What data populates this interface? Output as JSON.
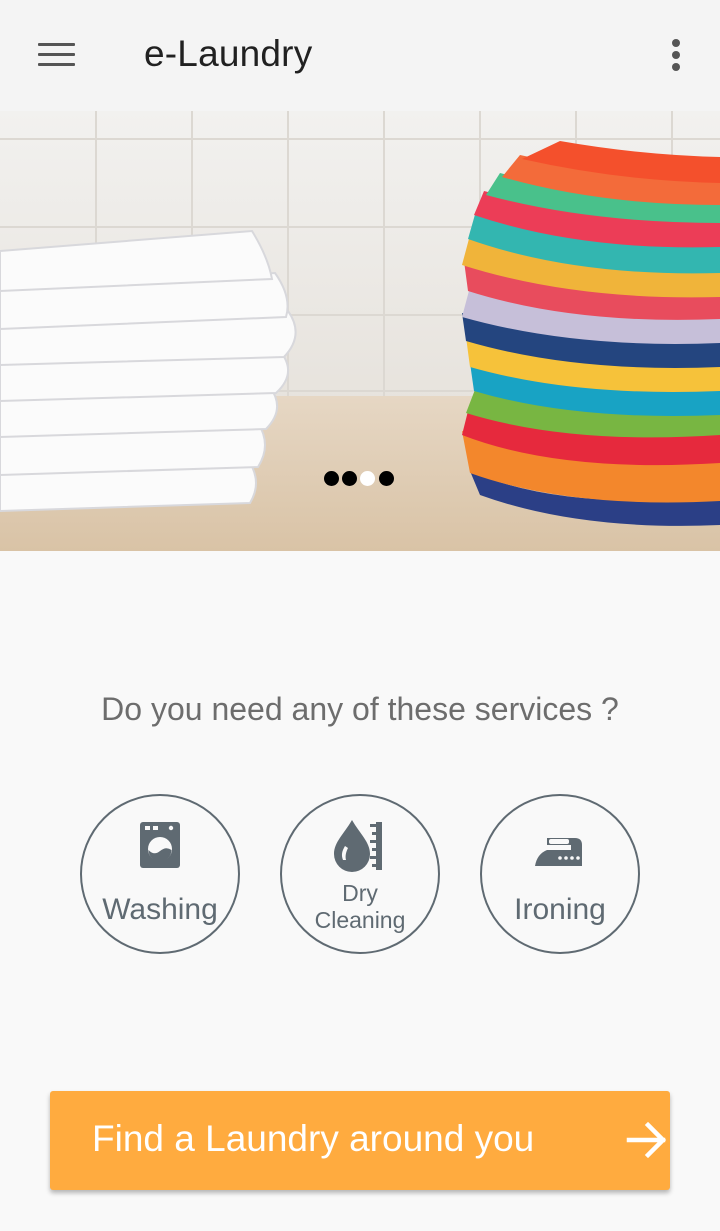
{
  "app_bar": {
    "title": "e-Laundry",
    "menu_icon": "hamburger-menu-icon",
    "overflow_icon": "more-vertical-icon"
  },
  "banner": {
    "slides_total": 4,
    "active_slide": 3,
    "dot_color_inactive": "#000000",
    "dot_color_active": "#ffffff"
  },
  "services": {
    "prompt": "Do you need any of these services ?",
    "items": [
      {
        "label_lines": [
          "Washing"
        ],
        "icon": "washing-machine-icon"
      },
      {
        "label_lines": [
          "Dry",
          "Cleaning"
        ],
        "icon": "dry-cleaning-drop-icon"
      },
      {
        "label_lines": [
          "Ironing"
        ],
        "icon": "iron-icon"
      }
    ],
    "outline_color": "#5f6a72"
  },
  "cta": {
    "label": "Find a Laundry around you",
    "icon": "arrow-right-icon",
    "color": "#ffab3f"
  }
}
